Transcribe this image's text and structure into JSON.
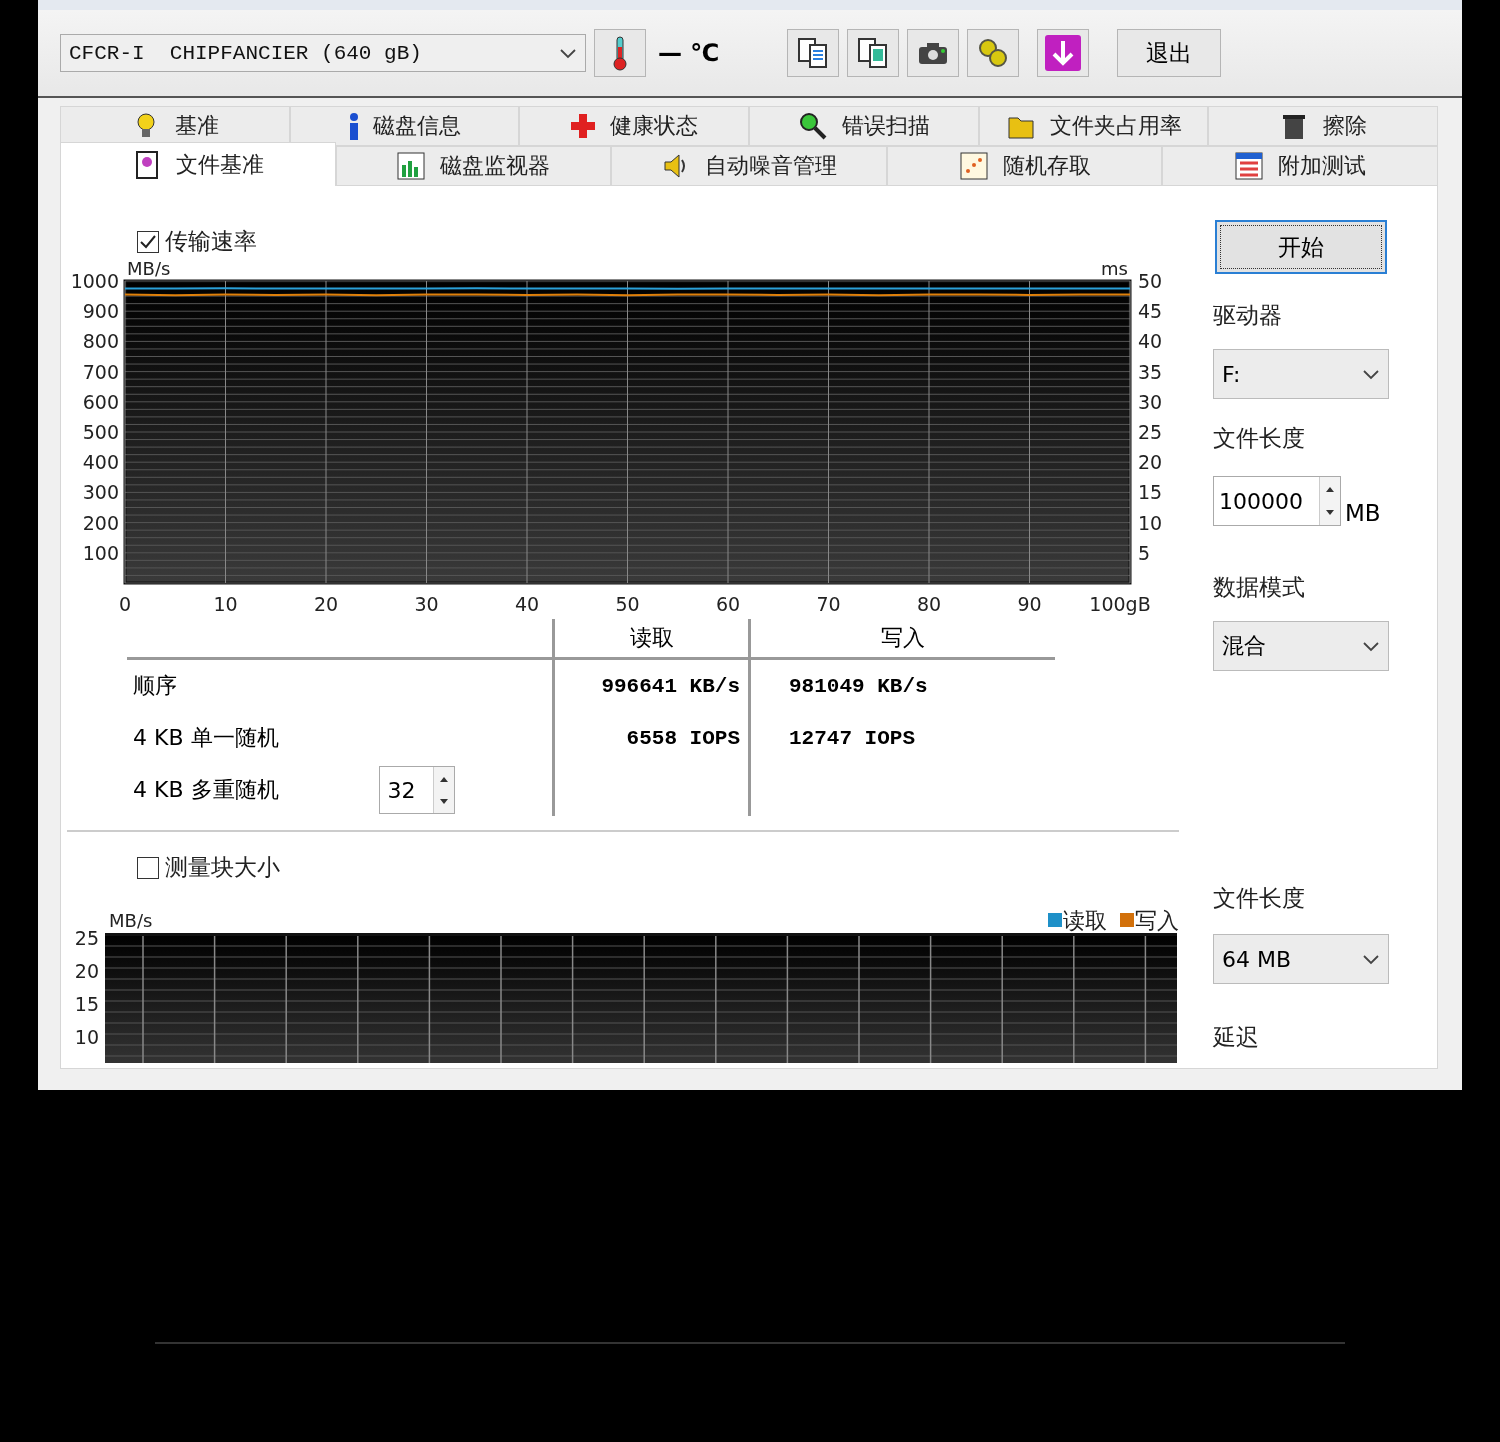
{
  "toolbar": {
    "drive": "CFCR-I  CHIPFANCIER (640 gB)",
    "temperature": "— ℃",
    "exit": "退出"
  },
  "tabs_top": [
    {
      "label": "基准",
      "selected": false
    },
    {
      "label": "磁盘信息",
      "selected": false
    },
    {
      "label": "健康状态",
      "selected": false
    },
    {
      "label": "错误扫描",
      "selected": false
    },
    {
      "label": "文件夹占用率",
      "selected": false
    },
    {
      "label": "擦除",
      "selected": false
    }
  ],
  "tabs_bottom": [
    {
      "label": "文件基准",
      "selected": true
    },
    {
      "label": "磁盘监视器",
      "selected": false
    },
    {
      "label": "自动噪音管理",
      "selected": false
    },
    {
      "label": "随机存取",
      "selected": false
    },
    {
      "label": "附加测试",
      "selected": false
    }
  ],
  "transfer": {
    "label": "传输速率",
    "checked": true,
    "chart_data": {
      "type": "line",
      "ylabel": "MB/s",
      "x": [
        0,
        5,
        10,
        15,
        20,
        25,
        30,
        35,
        40,
        45,
        50,
        55,
        60,
        65,
        70,
        75,
        80,
        85,
        90,
        95,
        100
      ],
      "series": [
        {
          "color": "#2aa0d8",
          "values": [
            975,
            975,
            976,
            975,
            975,
            975,
            975,
            976,
            975,
            975,
            975,
            974,
            975,
            975,
            975,
            975,
            975,
            975,
            975,
            975,
            975
          ]
        },
        {
          "color": "#e0800a",
          "values": [
            955,
            953,
            955,
            954,
            955,
            953,
            955,
            955,
            954,
            955,
            953,
            955,
            955,
            954,
            955,
            953,
            955,
            955,
            954,
            955,
            955
          ]
        }
      ],
      "xlim": [
        0,
        100
      ],
      "ylim": [
        0,
        1000
      ],
      "grid": true,
      "xticks": [
        0,
        10,
        20,
        30,
        40,
        50,
        60,
        70,
        80,
        90,
        {
          "value": 100,
          "label": "100gB"
        }
      ],
      "yticks": [
        100,
        200,
        300,
        400,
        500,
        600,
        700,
        800,
        900,
        1000
      ]
    },
    "right_axis": {
      "label": "ms",
      "ticks": [
        "50",
        "45",
        "40",
        "35",
        "30",
        "25",
        "20",
        "15",
        "10",
        "5"
      ]
    }
  },
  "results": {
    "columns": [
      "读取",
      "写入"
    ],
    "rows": [
      {
        "label": "顺序",
        "read": "996641 KB/s",
        "write": "981049 KB/s"
      },
      {
        "label": "4 KB 单一随机",
        "read": "6558 IOPS",
        "write": "12747 IOPS"
      },
      {
        "label": "4 KB 多重随机",
        "queue": "32"
      }
    ]
  },
  "block": {
    "label": "测量块大小",
    "checked": false,
    "ylabel": "MB/s",
    "yticks": [
      "25",
      "20",
      "15",
      "10"
    ],
    "legend": [
      {
        "label": "读取",
        "color": "#1e90c8"
      },
      {
        "label": "写入",
        "color": "#d2700a"
      }
    ]
  },
  "side": {
    "start": "开始",
    "drive_label": "驱动器",
    "drive": "F:",
    "length_label": "文件长度",
    "length": "100000",
    "length_unit": "MB",
    "mode_label": "数据模式",
    "mode": "混合",
    "block_length_label": "文件长度",
    "block_length": "64 MB",
    "delay_label": "延迟"
  }
}
